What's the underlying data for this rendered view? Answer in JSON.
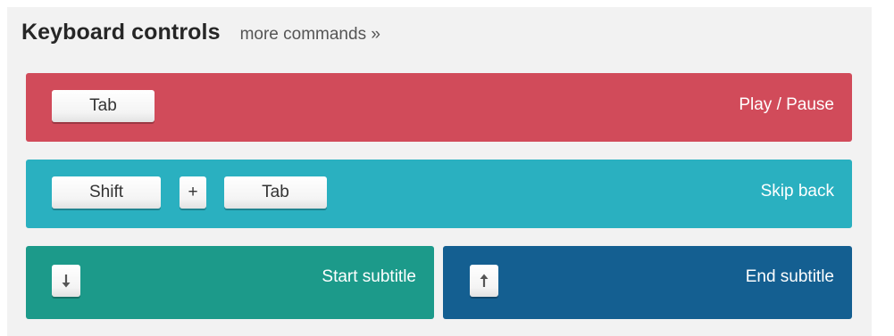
{
  "header": {
    "title": "Keyboard controls",
    "more_link": "more commands »"
  },
  "rows": [
    {
      "id": "play-pause",
      "color": "#d14b5a",
      "keys": [
        "Tab"
      ],
      "action": "Play / Pause"
    },
    {
      "id": "skip-back",
      "color": "#2ab0c0",
      "keys": [
        "Shift",
        "+",
        "Tab"
      ],
      "action": "Skip back"
    },
    {
      "id": "start-subtitle",
      "color": "#1c9a8a",
      "keys": [
        "arrow-down-icon"
      ],
      "action": "Start subtitle"
    },
    {
      "id": "end-subtitle",
      "color": "#145f91",
      "keys": [
        "arrow-up-icon"
      ],
      "action": "End subtitle"
    }
  ]
}
